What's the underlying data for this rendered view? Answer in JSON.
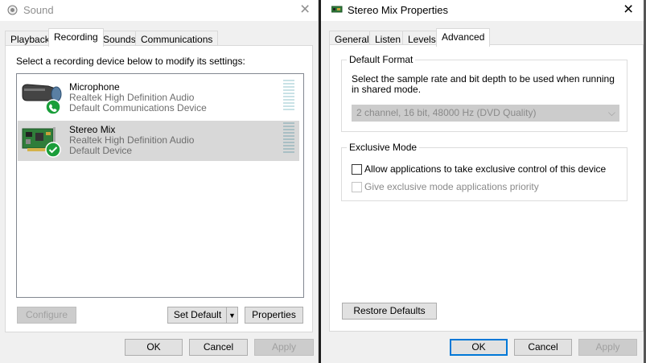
{
  "sound_dialog": {
    "title": "Sound",
    "tabs": [
      "Playback",
      "Recording",
      "Sounds",
      "Communications"
    ],
    "active_tab": "Recording",
    "instruction": "Select a recording device below to modify its settings:",
    "devices": [
      {
        "name": "Microphone",
        "driver": "Realtek High Definition Audio",
        "status": "Default Communications Device",
        "icon": "microphone-icon",
        "badge": "phone-check-badge",
        "selected": false
      },
      {
        "name": "Stereo Mix",
        "driver": "Realtek High Definition Audio",
        "status": "Default Device",
        "icon": "sound-card-icon",
        "badge": "checkmark-badge",
        "selected": true
      }
    ],
    "buttons": {
      "configure": "Configure",
      "set_default": "Set Default",
      "properties": "Properties",
      "ok": "OK",
      "cancel": "Cancel",
      "apply": "Apply"
    }
  },
  "props_dialog": {
    "title": "Stereo Mix Properties",
    "tabs": [
      "General",
      "Listen",
      "Levels",
      "Advanced"
    ],
    "active_tab": "Advanced",
    "default_format": {
      "title": "Default Format",
      "description_line1": "Select the sample rate and bit depth to be used when running",
      "description_line2": "in shared mode.",
      "selected_value": "2 channel, 16 bit, 48000 Hz (DVD Quality)"
    },
    "exclusive_mode": {
      "title": "Exclusive Mode",
      "allow_label": "Allow applications to take exclusive control of this device",
      "allow_checked": false,
      "priority_label": "Give exclusive mode applications priority",
      "priority_checked": false,
      "priority_enabled": false
    },
    "buttons": {
      "restore_defaults": "Restore Defaults",
      "ok": "OK",
      "cancel": "Cancel",
      "apply": "Apply"
    }
  },
  "colors": {
    "accent": "#0078d7",
    "selection": "#d8d8d8",
    "status_green": "#1a9e3a",
    "disabled_text": "#a0a0a0"
  }
}
